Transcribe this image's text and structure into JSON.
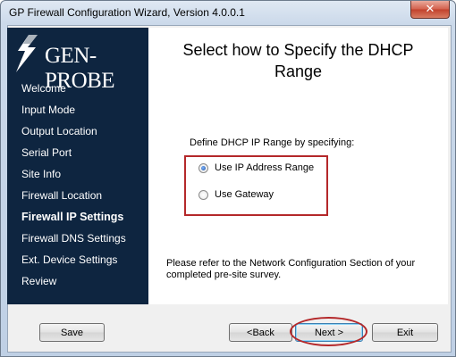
{
  "window": {
    "title": "GP Firewall Configuration Wizard, Version 4.0.0.1",
    "close_glyph": "✕"
  },
  "sidebar": {
    "logo_text": "GEN-PROBE",
    "items": [
      {
        "label": "Welcome"
      },
      {
        "label": "Input Mode"
      },
      {
        "label": "Output Location"
      },
      {
        "label": "Serial Port"
      },
      {
        "label": "Site Info"
      },
      {
        "label": "Firewall Location"
      },
      {
        "label": "Firewall IP Settings",
        "active": true
      },
      {
        "label": "Firewall DNS Settings"
      },
      {
        "label": "Ext. Device Settings"
      },
      {
        "label": "Review"
      }
    ]
  },
  "main": {
    "heading_line1": "Select how to Specify the DHCP",
    "heading_line2": "Range",
    "define_label": "Define DHCP IP Range by specifying:",
    "options": [
      {
        "label": "Use IP Address Range",
        "selected": true
      },
      {
        "label": "Use Gateway",
        "selected": false
      }
    ],
    "note_line1": "Please refer to the Network Configuration Section of your",
    "note_line2": "completed pre-site survey."
  },
  "buttons": {
    "save": "Save",
    "back": "<Back",
    "next": "Next >",
    "exit": "Exit"
  },
  "colors": {
    "sidebar_bg": "#0e2540",
    "annotation_red": "#b4282a"
  }
}
